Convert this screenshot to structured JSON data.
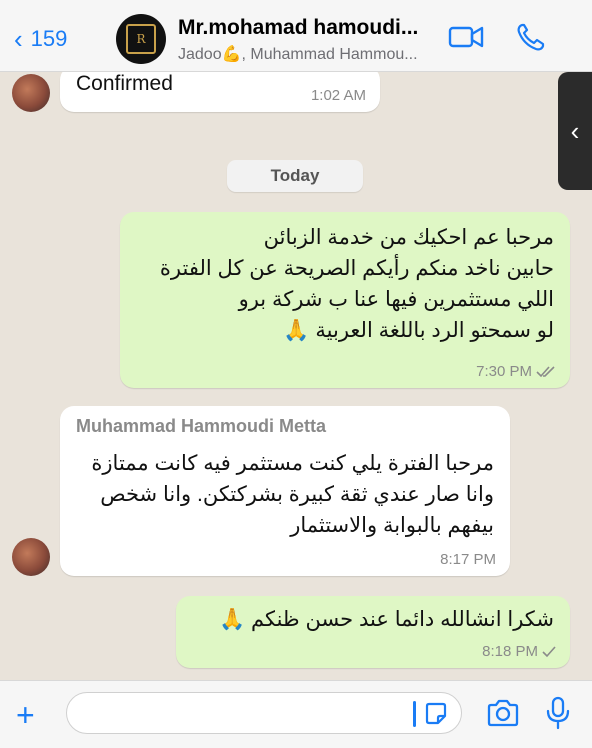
{
  "header": {
    "back_count": "159",
    "title": "Mr.mohamad hamoudi...",
    "subtitle": "Jadoo💪, Muhammad Hammou..."
  },
  "messages": [
    {
      "dir": "in",
      "text": "Confirmed",
      "time": "1:02 AM"
    },
    {
      "dir": "out",
      "lines": [
        "مرحبا عم احكيك من خدمة الزبائن",
        "حابين ناخد منكم رأيكم الصريحة عن كل الفترة",
        "اللي مستثمرين فيها عنا ب شركة برو",
        "لو سمحتو الرد باللغة العربية 🙏"
      ],
      "time": "7:30 PM",
      "status": "read"
    },
    {
      "dir": "in",
      "sender": "Muhammad Hammoudi Metta",
      "lines": [
        "مرحبا الفترة يلي كنت مستثمر فيه كانت ممتازة",
        "وانا صار عندي ثقة كبيرة بشركتكن. وانا شخص",
        "بيفهم بالبوابة والاستثمار"
      ],
      "time": "8:17 PM"
    },
    {
      "dir": "out",
      "lines": [
        "شكرا انشالله دائما عند حسن ظنكم 🙏"
      ],
      "time": "8:18 PM",
      "status": "sent"
    }
  ],
  "date_divider": "Today",
  "icons": {
    "back": "chevron-left-icon",
    "video": "video-camera-icon",
    "phone": "phone-icon",
    "attach": "plus-icon",
    "sticker": "sticker-icon",
    "camera": "camera-icon",
    "mic": "microphone-icon"
  },
  "colors": {
    "accent": "#1a7cf5",
    "outgoing": "#dff7c5",
    "incoming": "#ffffff"
  },
  "input": {
    "value": "",
    "placeholder": ""
  }
}
